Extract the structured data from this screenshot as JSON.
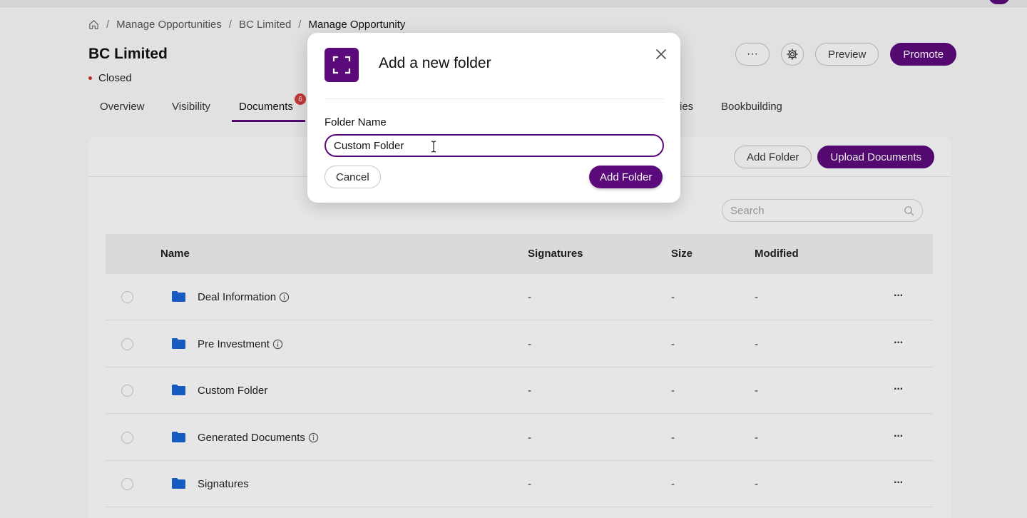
{
  "breadcrumb": {
    "items": [
      "Manage Opportunities",
      "BC Limited"
    ],
    "current": "Manage Opportunity",
    "separator": "/"
  },
  "header": {
    "title": "BC Limited",
    "status": "Closed",
    "more_label": "···",
    "preview_label": "Preview",
    "promote_label": "Promote"
  },
  "tabs": {
    "items": [
      {
        "label": "Overview"
      },
      {
        "label": "Visibility"
      },
      {
        "label": "Documents",
        "badge": "6",
        "active": true
      },
      {
        "label": "ies"
      },
      {
        "label": "Bookbuilding"
      }
    ]
  },
  "documents": {
    "add_folder_label": "Add Folder",
    "upload_label": "Upload Documents",
    "search_placeholder": "Search",
    "columns": [
      "Name",
      "Signatures",
      "Size",
      "Modified"
    ],
    "rows": [
      {
        "name": "Deal Information",
        "info": true,
        "signatures": "-",
        "size": "-",
        "modified": "-"
      },
      {
        "name": "Pre Investment",
        "info": true,
        "signatures": "-",
        "size": "-",
        "modified": "-"
      },
      {
        "name": "Custom Folder",
        "info": false,
        "signatures": "-",
        "size": "-",
        "modified": "-"
      },
      {
        "name": "Generated Documents",
        "info": true,
        "signatures": "-",
        "size": "-",
        "modified": "-"
      },
      {
        "name": "Signatures",
        "info": false,
        "signatures": "-",
        "size": "-",
        "modified": "-"
      }
    ],
    "row_more_label": "···"
  },
  "modal": {
    "title": "Add a new folder",
    "field_label": "Folder Name",
    "field_value": "Custom Folder",
    "cancel_label": "Cancel",
    "submit_label": "Add Folder",
    "icon": "folder-frame-icon"
  },
  "colors": {
    "brand": "#5a0a7a",
    "badge": "#d23c3c",
    "folder": "#1a63d0",
    "status_dot": "#c0392b"
  }
}
